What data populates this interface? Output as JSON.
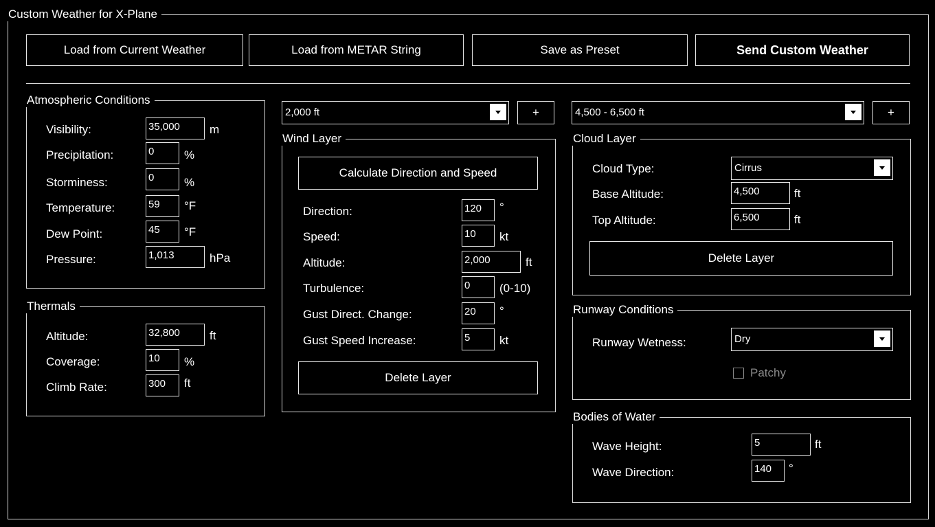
{
  "window": {
    "title": "Custom Weather for X-Plane"
  },
  "toolbar": {
    "load_current": "Load from Current Weather",
    "load_metar": "Load from METAR String",
    "save_preset": "Save as Preset",
    "send": "Send Custom Weather"
  },
  "atmospheric": {
    "title": "Atmospheric Conditions",
    "visibility": {
      "label": "Visibility:",
      "value": "35,000",
      "unit": "m"
    },
    "precipitation": {
      "label": "Precipitation:",
      "value": "0",
      "unit": "%"
    },
    "storminess": {
      "label": "Storminess:",
      "value": "0",
      "unit": "%"
    },
    "temperature": {
      "label": "Temperature:",
      "value": "59",
      "unit": "°F"
    },
    "dew_point": {
      "label": "Dew Point:",
      "value": "45",
      "unit": "°F"
    },
    "pressure": {
      "label": "Pressure:",
      "value": "1,013",
      "unit": "hPa"
    }
  },
  "thermals": {
    "title": "Thermals",
    "altitude": {
      "label": "Altitude:",
      "value": "32,800",
      "unit": "ft"
    },
    "coverage": {
      "label": "Coverage:",
      "value": "10",
      "unit": "%"
    },
    "climb_rate": {
      "label": "Climb Rate:",
      "value": "300",
      "unit": "ft"
    }
  },
  "wind": {
    "layer_select": "2,000 ft",
    "add_label": "+",
    "title": "Wind Layer",
    "calculate": "Calculate Direction and Speed",
    "direction": {
      "label": "Direction:",
      "value": "120",
      "unit": "°"
    },
    "speed": {
      "label": "Speed:",
      "value": "10",
      "unit": "kt"
    },
    "altitude": {
      "label": "Altitude:",
      "value": "2,000",
      "unit": "ft"
    },
    "turbulence": {
      "label": "Turbulence:",
      "value": "0",
      "unit": "(0-10)"
    },
    "gust_dir": {
      "label": "Gust Direct. Change:",
      "value": "20",
      "unit": "°"
    },
    "gust_speed": {
      "label": "Gust Speed Increase:",
      "value": "5",
      "unit": "kt"
    },
    "delete": "Delete Layer"
  },
  "cloud": {
    "layer_select": "4,500 - 6,500 ft",
    "add_label": "+",
    "title": "Cloud Layer",
    "type": {
      "label": "Cloud Type:",
      "value": "Cirrus"
    },
    "base": {
      "label": "Base Altitude:",
      "value": "4,500",
      "unit": "ft"
    },
    "top": {
      "label": "Top Altitude:",
      "value": "6,500",
      "unit": "ft"
    },
    "delete": "Delete Layer"
  },
  "runway": {
    "title": "Runway Conditions",
    "wetness": {
      "label": "Runway Wetness:",
      "value": "Dry"
    },
    "patchy": "Patchy"
  },
  "water": {
    "title": "Bodies of Water",
    "wave_height": {
      "label": "Wave Height:",
      "value": "5",
      "unit": "ft"
    },
    "wave_direction": {
      "label": "Wave Direction:",
      "value": "140",
      "unit": "°"
    }
  }
}
